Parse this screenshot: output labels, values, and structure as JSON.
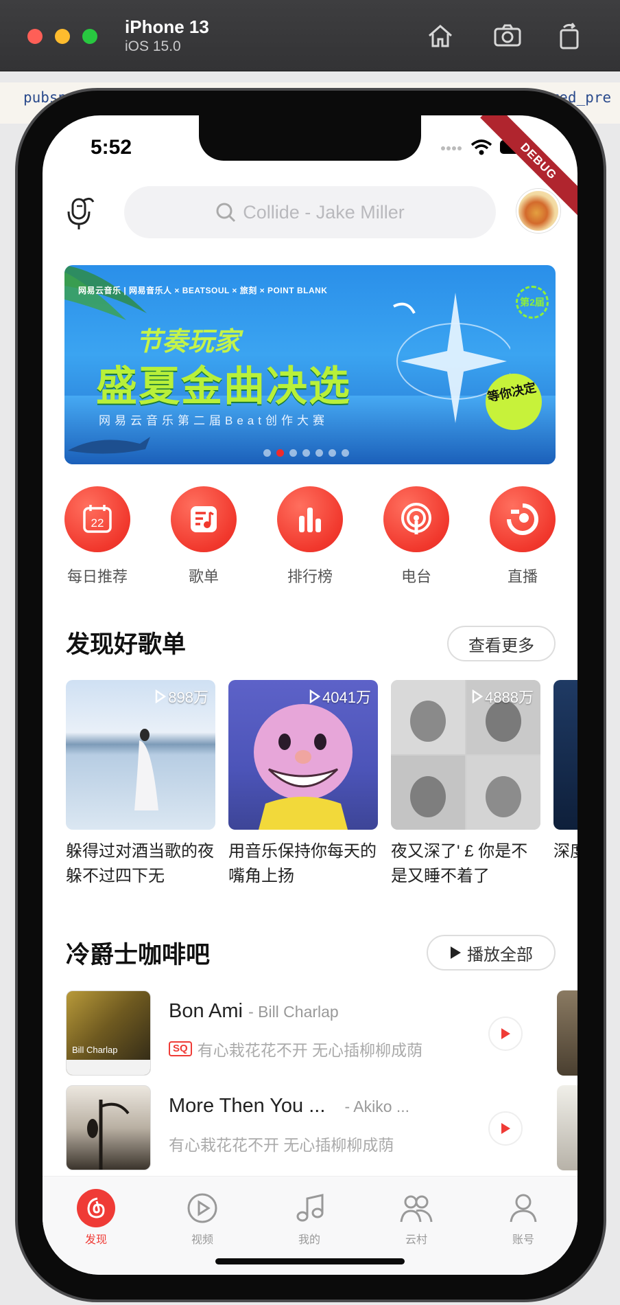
{
  "simulator": {
    "device_name": "iPhone 13",
    "os_version": "iOS 15.0"
  },
  "background_ide": {
    "left_text": "pubsp",
    "right_text": "ared_pre"
  },
  "status_bar": {
    "time": "5:52",
    "debug_label": "DEBUG"
  },
  "header": {
    "search_placeholder": "Collide - Jake Miller"
  },
  "banner": {
    "partners": "网易云音乐 | 网易音乐人 × BEATSOUL × 旅刻 × POINT BLANK",
    "subtitle": "节奏玩家",
    "title": "盛夏金曲决选",
    "description": "网易云音乐第二届Beat创作大赛",
    "badge": "第2届",
    "sticker": "等你决定",
    "page_count": 7,
    "active_page": 1
  },
  "quick_entries": [
    {
      "label": "每日推荐",
      "icon": "calendar-icon",
      "icon_text": "22"
    },
    {
      "label": "歌单",
      "icon": "playlist-icon"
    },
    {
      "label": "排行榜",
      "icon": "chart-bars-icon"
    },
    {
      "label": "电台",
      "icon": "radio-icon"
    },
    {
      "label": "直播",
      "icon": "live-icon"
    }
  ],
  "discover_section": {
    "title": "发现好歌单",
    "more_label": "查看更多",
    "playlists": [
      {
        "name": "躲得过对酒当歌的夜 躲不过四下无",
        "play_count": "898万"
      },
      {
        "name": "用音乐保持你每天的嘴角上扬",
        "play_count": "4041万"
      },
      {
        "name": "夜又深了' £ 你是不是又睡不着了",
        "play_count": "4888万"
      },
      {
        "name": "深度睡眠",
        "play_count": ""
      }
    ]
  },
  "jazz_section": {
    "title": "冷爵士咖啡吧",
    "play_all_label": "播放全部",
    "songs": [
      {
        "title": "Bon Ami",
        "artist": "- Bill Charlap",
        "quality_badge": "SQ",
        "subtitle": "有心栽花花不开 无心插柳柳成荫",
        "cover_text": "Bill Charlap"
      },
      {
        "title": "More Then You ...",
        "artist": "- Akiko ...",
        "quality_badge": "",
        "subtitle": "有心栽花花不开 无心插柳柳成荫",
        "cover_text": ""
      }
    ]
  },
  "tabbar": {
    "tabs": [
      {
        "label": "发现",
        "icon": "netease-music-icon",
        "active": true
      },
      {
        "label": "视频",
        "icon": "video-play-icon",
        "active": false
      },
      {
        "label": "我的",
        "icon": "music-note-icon",
        "active": false
      },
      {
        "label": "云村",
        "icon": "community-icon",
        "active": false
      },
      {
        "label": "账号",
        "icon": "user-icon",
        "active": false
      }
    ]
  },
  "colors": {
    "accent": "#ef3b36",
    "banner_green": "#b8f03a"
  }
}
